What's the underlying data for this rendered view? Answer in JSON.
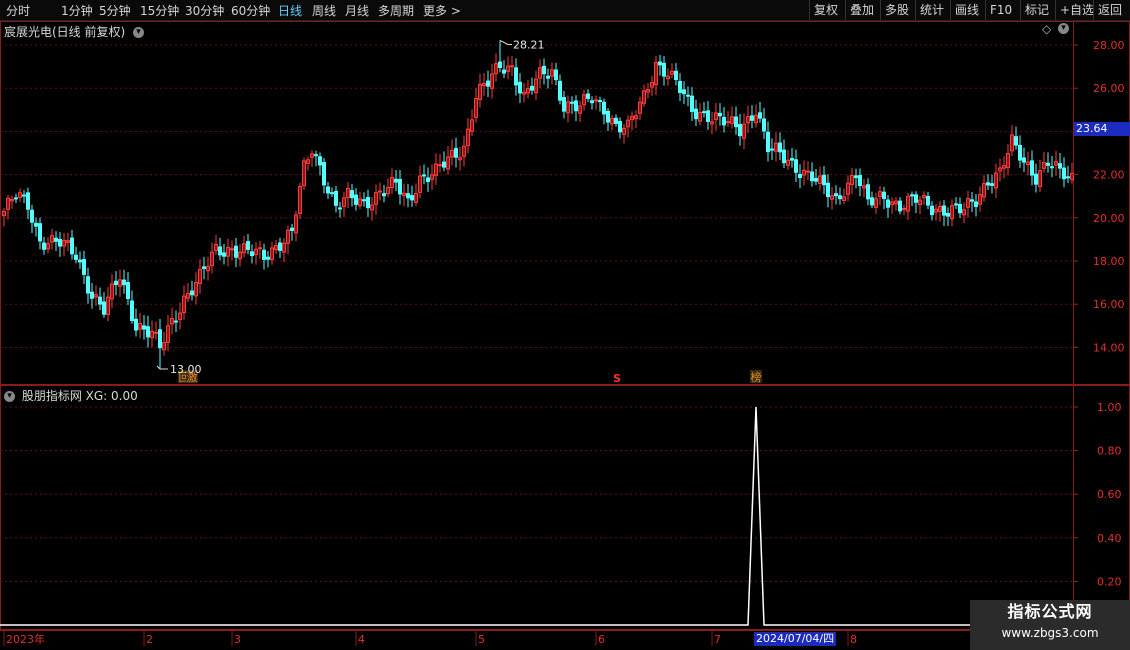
{
  "toolbar": {
    "left_items": [
      "分时",
      "1分钟",
      "5分钟",
      "15分钟",
      "30分钟",
      "60分钟",
      "日线",
      "周线",
      "月线",
      "多周期",
      "更多"
    ],
    "more_arrow": ">",
    "active": "日线",
    "right_items": [
      "复权",
      "叠加",
      "多股",
      "统计",
      "画线",
      "F10",
      "标记",
      "+自选",
      "返回"
    ]
  },
  "main_panel": {
    "title": "宸展光电(日线 前复权)",
    "high_label": "28.21",
    "low_label": "13.00",
    "current_price": "23.64",
    "markers": [
      {
        "text": "回",
        "color": "#e08a2c",
        "index": 45
      },
      {
        "text": "激",
        "color": "#e08a2c",
        "index": 47
      },
      {
        "text": "S",
        "color": "#ff3030",
        "index": 153
      },
      {
        "text": "榜",
        "color": "#e08a2c",
        "index": 188
      }
    ],
    "diamond_icon": "◇"
  },
  "indicator_panel": {
    "title": "股朋指标网 XG: 0.00"
  },
  "x_axis": {
    "labels": [
      {
        "text": "2023年",
        "index": 0
      },
      {
        "text": "2",
        "index": 35
      },
      {
        "text": "3",
        "index": 57
      },
      {
        "text": "4",
        "index": 88
      },
      {
        "text": "5",
        "index": 118
      },
      {
        "text": "6",
        "index": 148
      },
      {
        "text": "7",
        "index": 177
      },
      {
        "text": "8",
        "index": 211
      }
    ],
    "highlight_date": "2024/07/04/四"
  },
  "watermark": {
    "title": "指标公式网",
    "url": "www.zbgs3.com"
  },
  "chart_data": [
    {
      "type": "candlestick",
      "title": "宸展光电(日线 前复权)",
      "ylim": [
        12.5,
        29.5
      ],
      "y_ticks": [
        14.0,
        16.0,
        18.0,
        20.0,
        22.0,
        24.0,
        26.0,
        28.0
      ],
      "grid": true,
      "up_color": "#ff3b3b",
      "down_color": "#54ffff",
      "x": [
        0,
        1,
        2,
        3,
        4,
        5,
        6,
        7,
        8,
        9,
        10,
        11,
        12,
        13,
        14,
        15,
        16,
        17,
        18,
        19,
        20,
        21,
        22,
        23,
        24,
        25,
        26,
        27,
        28,
        29,
        30,
        31,
        32,
        33,
        34,
        35,
        36,
        37,
        38,
        39,
        40,
        41,
        42,
        43,
        44,
        45,
        46,
        47,
        48,
        49,
        50,
        51,
        52,
        53,
        54,
        55,
        56,
        57,
        58,
        59,
        60,
        61,
        62,
        63,
        64,
        65,
        66,
        67,
        68,
        69,
        70,
        71,
        72,
        73,
        74,
        75,
        76,
        77,
        78,
        79,
        80,
        81,
        82,
        83,
        84,
        85,
        86,
        87,
        88,
        89,
        90,
        91,
        92,
        93,
        94,
        95,
        96,
        97,
        98,
        99,
        100,
        101,
        102,
        103,
        104,
        105,
        106,
        107,
        108,
        109,
        110,
        111,
        112,
        113,
        114,
        115,
        116,
        117,
        118,
        119,
        120,
        121,
        122,
        123,
        124,
        125,
        126,
        127,
        128,
        129,
        130,
        131,
        132,
        133,
        134,
        135,
        136,
        137,
        138,
        139,
        140,
        141,
        142,
        143,
        144,
        145,
        146,
        147,
        148,
        149,
        150,
        151,
        152,
        153,
        154,
        155,
        156,
        157,
        158,
        159,
        160,
        161,
        162,
        163,
        164,
        165,
        166,
        167,
        168,
        169,
        170,
        171,
        172,
        173,
        174,
        175,
        176,
        177,
        178,
        179,
        180,
        181,
        182,
        183,
        184,
        185,
        186,
        187,
        188,
        189,
        190,
        191,
        192,
        193,
        194,
        195,
        196,
        197,
        198,
        199,
        200,
        201,
        202,
        203,
        204,
        205,
        206,
        207,
        208,
        209,
        210,
        211,
        212,
        213,
        214,
        215,
        216,
        217,
        218,
        219,
        220,
        221,
        222,
        223,
        224,
        225,
        226,
        227,
        228,
        229,
        230,
        231,
        232,
        233,
        234,
        235,
        236,
        237,
        238,
        239,
        240,
        241,
        242,
        243,
        244,
        245,
        246,
        247,
        248,
        249,
        250,
        251,
        252,
        253,
        254,
        255,
        256,
        257,
        258,
        259,
        260,
        261,
        262,
        263,
        264,
        265,
        266,
        267
      ],
      "waypoints": [
        [
          0,
          20.3
        ],
        [
          3,
          21.0
        ],
        [
          6,
          20.6
        ],
        [
          9,
          19.0
        ],
        [
          14,
          18.8
        ],
        [
          18,
          18.3
        ],
        [
          22,
          16.5
        ],
        [
          25,
          15.7
        ],
        [
          29,
          17.3
        ],
        [
          33,
          15.1
        ],
        [
          37,
          14.6
        ],
        [
          39,
          13.9
        ],
        [
          41,
          14.8
        ],
        [
          45,
          16.3
        ],
        [
          49,
          17.2
        ],
        [
          53,
          18.5
        ],
        [
          57,
          18.6
        ],
        [
          61,
          18.4
        ],
        [
          65,
          18.2
        ],
        [
          69,
          18.9
        ],
        [
          72,
          19.3
        ],
        [
          75,
          22.2
        ],
        [
          77,
          23.2
        ],
        [
          79,
          22.4
        ],
        [
          83,
          20.5
        ],
        [
          86,
          20.9
        ],
        [
          90,
          20.7
        ],
        [
          94,
          21.2
        ],
        [
          98,
          21.5
        ],
        [
          101,
          20.7
        ],
        [
          104,
          21.9
        ],
        [
          108,
          22.1
        ],
        [
          112,
          22.8
        ],
        [
          115,
          23.3
        ],
        [
          118,
          25.7
        ],
        [
          121,
          26.2
        ],
        [
          124,
          27.0
        ],
        [
          127,
          27.0
        ],
        [
          130,
          25.6
        ],
        [
          134,
          26.5
        ],
        [
          137,
          26.8
        ],
        [
          140,
          25.3
        ],
        [
          144,
          25.1
        ],
        [
          147,
          25.5
        ],
        [
          150,
          25.1
        ],
        [
          153,
          24.3
        ],
        [
          156,
          24.1
        ],
        [
          160,
          25.6
        ],
        [
          163,
          27.2
        ],
        [
          166,
          26.7
        ],
        [
          169,
          25.9
        ],
        [
          172,
          25.0
        ],
        [
          176,
          24.8
        ],
        [
          180,
          24.4
        ],
        [
          184,
          24.1
        ],
        [
          188,
          25.1
        ],
        [
          191,
          23.2
        ],
        [
          194,
          22.9
        ],
        [
          198,
          22.4
        ],
        [
          202,
          21.9
        ],
        [
          205,
          21.3
        ],
        [
          208,
          20.8
        ],
        [
          210,
          21.4
        ],
        [
          213,
          22.1
        ],
        [
          216,
          20.6
        ],
        [
          220,
          21.0
        ],
        [
          224,
          20.6
        ],
        [
          228,
          20.8
        ],
        [
          232,
          20.5
        ],
        [
          236,
          20.4
        ],
        [
          240,
          20.3
        ],
        [
          243,
          20.8
        ],
        [
          246,
          21.8
        ],
        [
          249,
          22.1
        ],
        [
          252,
          23.4
        ],
        [
          255,
          22.6
        ],
        [
          258,
          22.0
        ],
        [
          261,
          22.6
        ],
        [
          264,
          22.0
        ],
        [
          267,
          21.8
        ]
      ],
      "high_point": {
        "index": 124,
        "value": 28.21
      },
      "low_point": {
        "index": 39,
        "value": 13.0
      }
    },
    {
      "type": "line",
      "title": "股朋指标网 XG: 0.00",
      "series": [
        {
          "name": "XG",
          "color": "#ffffff"
        }
      ],
      "ylim": [
        0,
        1.05
      ],
      "y_ticks": [
        0.2,
        0.4,
        0.6,
        0.8,
        1.0
      ],
      "spike": {
        "index": 188,
        "value": 1.0
      },
      "baseline": 0.0,
      "grid": true
    }
  ]
}
